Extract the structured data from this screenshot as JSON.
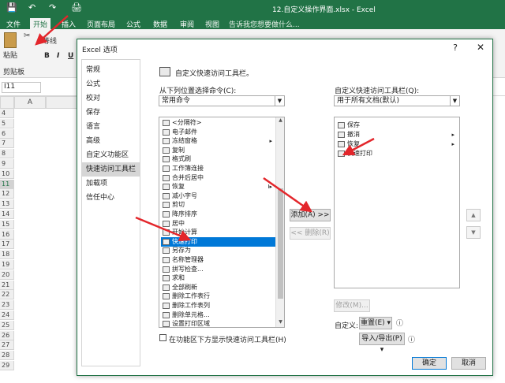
{
  "excel": {
    "window_title": "12.自定义操作界面.xlsx - Excel",
    "tabs": [
      "文件",
      "开始",
      "插入",
      "页面布局",
      "公式",
      "数据",
      "审阅",
      "视图"
    ],
    "tell_me": "告诉我您想要做什么...",
    "ribbon": {
      "paste": "粘贴",
      "clipboard": "剪贴板",
      "font_name": "等线",
      "bold": "B",
      "italic": "I",
      "underline": "U"
    },
    "name_box": "I11",
    "column_a": "A",
    "rows": [
      "4",
      "5",
      "6",
      "7",
      "8",
      "9",
      "10",
      "11",
      "12",
      "13",
      "14",
      "15",
      "16",
      "17",
      "18",
      "19",
      "20",
      "21",
      "22",
      "23",
      "24",
      "25",
      "26",
      "27",
      "28",
      "29"
    ]
  },
  "dialog": {
    "title": "Excel 选项",
    "help": "?",
    "close": "✕",
    "nav": [
      "常规",
      "公式",
      "校对",
      "保存",
      "语言",
      "高级",
      "自定义功能区",
      "快速访问工具栏",
      "加载项",
      "信任中心"
    ],
    "header": "自定义快速访问工具栏。",
    "choose_label": "从下列位置选择命令(C):",
    "choose_value": "常用命令",
    "customize_label": "自定义快速访问工具栏(Q):",
    "customize_value": "用于所有文档(默认)",
    "commands": [
      {
        "label": "<分隔符>",
        "sub": ""
      },
      {
        "label": "电子邮件",
        "sub": ""
      },
      {
        "label": "冻结窗格",
        "sub": "▸"
      },
      {
        "label": "复制",
        "sub": ""
      },
      {
        "label": "格式刷",
        "sub": ""
      },
      {
        "label": "工作簿连接",
        "sub": ""
      },
      {
        "label": "合并后居中",
        "sub": ""
      },
      {
        "label": "恢复",
        "sub": "I▸"
      },
      {
        "label": "减小字号",
        "sub": ""
      },
      {
        "label": "剪切",
        "sub": ""
      },
      {
        "label": "降序排序",
        "sub": ""
      },
      {
        "label": "居中",
        "sub": ""
      },
      {
        "label": "开始计算",
        "sub": ""
      },
      {
        "label": "快速打印",
        "sub": ""
      },
      {
        "label": "另存为",
        "sub": ""
      },
      {
        "label": "名称管理器",
        "sub": ""
      },
      {
        "label": "拼写检查...",
        "sub": ""
      },
      {
        "label": "求和",
        "sub": ""
      },
      {
        "label": "全部刷新",
        "sub": ""
      },
      {
        "label": "删除工作表行",
        "sub": ""
      },
      {
        "label": "删除工作表列",
        "sub": ""
      },
      {
        "label": "删除单元格...",
        "sub": ""
      },
      {
        "label": "设置打印区域",
        "sub": ""
      }
    ],
    "selected_command": "快速打印",
    "qat_items": [
      {
        "label": "保存",
        "sub": ""
      },
      {
        "label": "撤消",
        "sub": "▸"
      },
      {
        "label": "恢复",
        "sub": "▸"
      },
      {
        "label": "快速打印",
        "sub": ""
      }
    ],
    "add_button": "添加(A) >>",
    "remove_button": "<< 删除(R)",
    "modify_button": "修改(M)...",
    "customize_label2": "自定义:",
    "reset_button": "重置(E) ▾",
    "import_export_button": "导入/导出(P) ▾",
    "show_below_label": "在功能区下方显示快速访问工具栏(H)",
    "ok_button": "确定",
    "cancel_button": "取消"
  }
}
